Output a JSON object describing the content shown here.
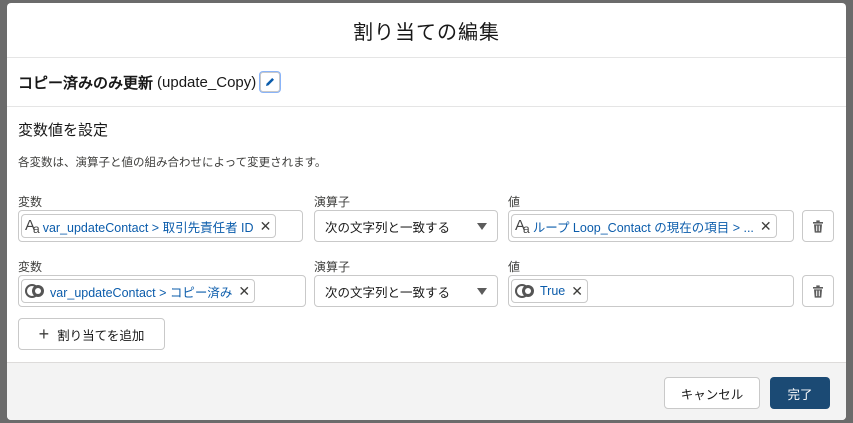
{
  "modal": {
    "title": "割り当ての編集",
    "element_name": "コピー済みのみ更新",
    "element_api_name": "(update_Copy)"
  },
  "section": {
    "title": "変数値を設定",
    "description": "各変数は、演算子と値の組み合わせによって変更されます。"
  },
  "rows": [
    {
      "variable_label": "変数",
      "variable_icon": "text-type-icon",
      "variable_value": "var_updateContact > 取引先責任者 ID",
      "operator_label": "演算子",
      "operator_value": "次の文字列と一致する",
      "value_label": "値",
      "value_icon": "text-type-icon",
      "value_value": "ループ Loop_Contact の現在の項目 > ..."
    },
    {
      "variable_label": "変数",
      "variable_icon": "boolean-toggle-icon",
      "variable_value": "var_updateContact > コピー済み",
      "operator_label": "演算子",
      "operator_value": "次の文字列と一致する",
      "value_label": "値",
      "value_icon": "boolean-toggle-icon",
      "value_value": "True"
    }
  ],
  "add_button_label": "割り当てを追加",
  "footer": {
    "cancel_label": "キャンセル",
    "done_label": "完了"
  },
  "colors": {
    "primary": "#1b4a74",
    "link": "#0b5cab",
    "border": "#c9c9c9"
  }
}
